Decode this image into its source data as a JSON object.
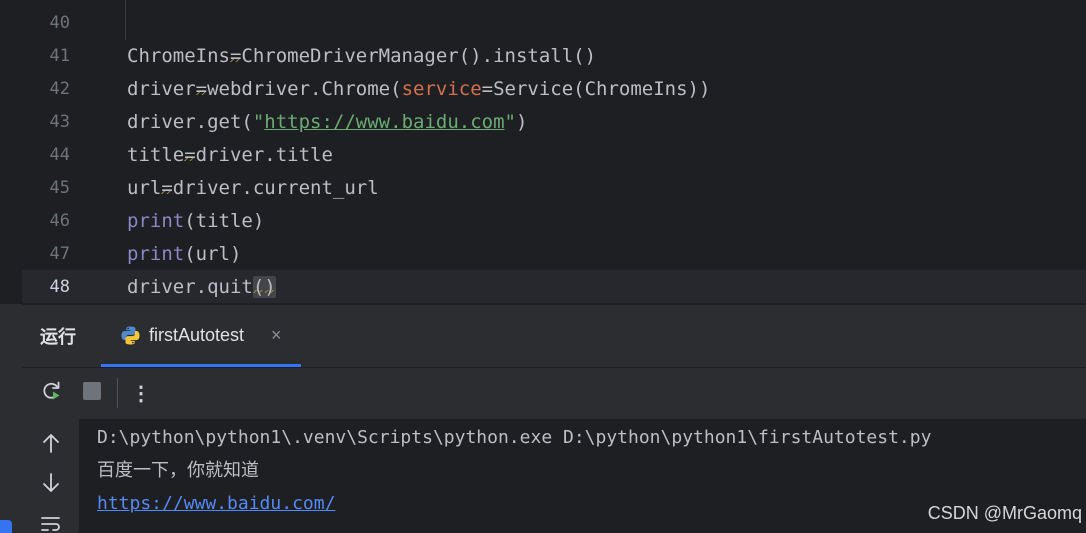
{
  "editor": {
    "line_numbers": [
      "40",
      "41",
      "42",
      "43",
      "44",
      "45",
      "46",
      "47",
      "48"
    ],
    "lines": {
      "l41": {
        "a": "ChromeIns",
        "b": "=",
        "c": "ChromeDriverManager().install()"
      },
      "l42": {
        "a": "driver",
        "b": "=",
        "c": "webdriver.Chrome(",
        "d": "service",
        "e": "=Service(ChromeIns))"
      },
      "l43": {
        "a": "driver.get(",
        "b": "\"",
        "c": "https://www.baidu.com",
        "d": "\"",
        "e": ")"
      },
      "l44": {
        "a": "title",
        "b": "=",
        "c": "driver.title"
      },
      "l45": {
        "a": "url",
        "b": "=",
        "c": "driver.current_url"
      },
      "l46": {
        "a": "print",
        "b": "(title)"
      },
      "l47": {
        "a": "print",
        "b": "(url)"
      },
      "l48": {
        "a": "driver.quit",
        "b": "()"
      }
    }
  },
  "run_window": {
    "title": "运行",
    "tab_label": "firstAutotest",
    "close_glyph": "×",
    "more_glyph": "⋮",
    "toolbar_icons": [
      "rerun-icon",
      "stop-icon",
      "more-icon"
    ],
    "side_icons": [
      "arrow-up-icon",
      "arrow-down-icon",
      "soft-wrap-icon"
    ]
  },
  "console": {
    "lines": [
      "D:\\python\\python1\\.venv\\Scripts\\python.exe D:\\python\\python1\\firstAutotest.py",
      "百度一下，你就知道",
      "https://www.baidu.com/"
    ]
  },
  "watermark": "CSDN @MrGaomq",
  "colors": {
    "editor_bg": "#1e1f22",
    "panel_bg": "#2b2d30",
    "accent": "#3574f0",
    "keyword": "#56a8f5",
    "string": "#6aab73",
    "param": "#d46f4f",
    "builtin": "#8888c6",
    "link": "#548af7"
  }
}
